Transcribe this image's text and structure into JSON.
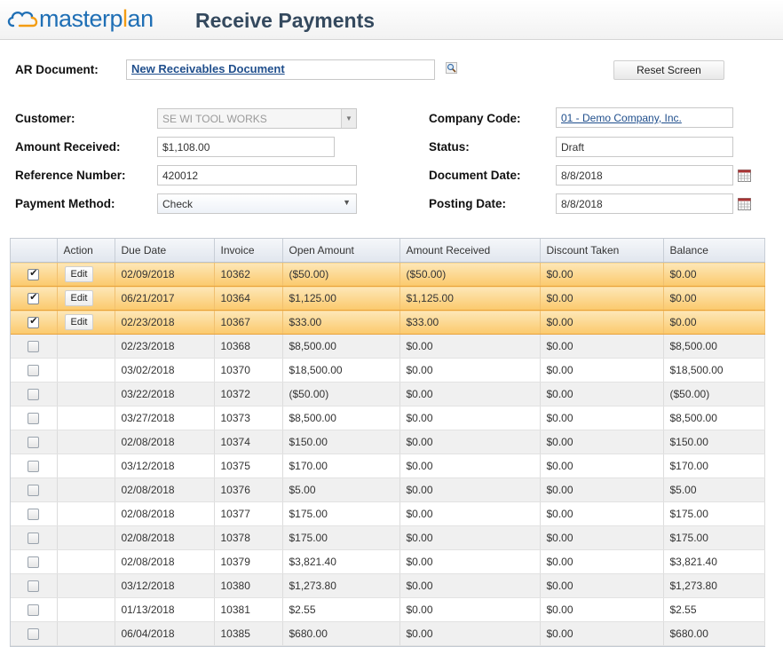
{
  "app": {
    "logo_text_a": "masterp",
    "logo_text_b": "l",
    "logo_text_c": "an",
    "page_title": "Receive Payments"
  },
  "header": {
    "ar_document_label": "AR Document:",
    "ar_document_value": "New Receivables Document",
    "reset_label": "Reset Screen"
  },
  "form": {
    "customer_label": "Customer:",
    "customer_value": "SE WI TOOL WORKS",
    "amount_label": "Amount Received:",
    "amount_value": "$1,108.00",
    "reference_label": "Reference Number:",
    "reference_value": "420012",
    "payment_method_label": "Payment Method:",
    "payment_method_value": "Check",
    "company_code_label": "Company Code:",
    "company_code_value": "01 - Demo Company, Inc.",
    "status_label": "Status:",
    "status_value": "Draft",
    "document_date_label": "Document Date:",
    "document_date_value": "8/8/2018",
    "posting_date_label": "Posting Date:",
    "posting_date_value": "8/8/2018"
  },
  "grid": {
    "columns": [
      "",
      "Action",
      "Due Date",
      "Invoice",
      "Open Amount",
      "Amount Received",
      "Discount Taken",
      "Balance"
    ],
    "edit_label": "Edit",
    "rows": [
      {
        "checked": true,
        "due": "02/09/2018",
        "invoice": "10362",
        "open": "($50.00)",
        "received": "($50.00)",
        "discount": "$0.00",
        "balance": "$0.00"
      },
      {
        "checked": true,
        "due": "06/21/2017",
        "invoice": "10364",
        "open": "$1,125.00",
        "received": "$1,125.00",
        "discount": "$0.00",
        "balance": "$0.00"
      },
      {
        "checked": true,
        "due": "02/23/2018",
        "invoice": "10367",
        "open": "$33.00",
        "received": "$33.00",
        "discount": "$0.00",
        "balance": "$0.00"
      },
      {
        "checked": false,
        "due": "02/23/2018",
        "invoice": "10368",
        "open": "$8,500.00",
        "received": "$0.00",
        "discount": "$0.00",
        "balance": "$8,500.00"
      },
      {
        "checked": false,
        "due": "03/02/2018",
        "invoice": "10370",
        "open": "$18,500.00",
        "received": "$0.00",
        "discount": "$0.00",
        "balance": "$18,500.00"
      },
      {
        "checked": false,
        "due": "03/22/2018",
        "invoice": "10372",
        "open": "($50.00)",
        "received": "$0.00",
        "discount": "$0.00",
        "balance": "($50.00)"
      },
      {
        "checked": false,
        "due": "03/27/2018",
        "invoice": "10373",
        "open": "$8,500.00",
        "received": "$0.00",
        "discount": "$0.00",
        "balance": "$8,500.00"
      },
      {
        "checked": false,
        "due": "02/08/2018",
        "invoice": "10374",
        "open": "$150.00",
        "received": "$0.00",
        "discount": "$0.00",
        "balance": "$150.00"
      },
      {
        "checked": false,
        "due": "03/12/2018",
        "invoice": "10375",
        "open": "$170.00",
        "received": "$0.00",
        "discount": "$0.00",
        "balance": "$170.00"
      },
      {
        "checked": false,
        "due": "02/08/2018",
        "invoice": "10376",
        "open": "$5.00",
        "received": "$0.00",
        "discount": "$0.00",
        "balance": "$5.00"
      },
      {
        "checked": false,
        "due": "02/08/2018",
        "invoice": "10377",
        "open": "$175.00",
        "received": "$0.00",
        "discount": "$0.00",
        "balance": "$175.00"
      },
      {
        "checked": false,
        "due": "02/08/2018",
        "invoice": "10378",
        "open": "$175.00",
        "received": "$0.00",
        "discount": "$0.00",
        "balance": "$175.00"
      },
      {
        "checked": false,
        "due": "02/08/2018",
        "invoice": "10379",
        "open": "$3,821.40",
        "received": "$0.00",
        "discount": "$0.00",
        "balance": "$3,821.40"
      },
      {
        "checked": false,
        "due": "03/12/2018",
        "invoice": "10380",
        "open": "$1,273.80",
        "received": "$0.00",
        "discount": "$0.00",
        "balance": "$1,273.80"
      },
      {
        "checked": false,
        "due": "01/13/2018",
        "invoice": "10381",
        "open": "$2.55",
        "received": "$0.00",
        "discount": "$0.00",
        "balance": "$2.55"
      },
      {
        "checked": false,
        "due": "06/04/2018",
        "invoice": "10385",
        "open": "$680.00",
        "received": "$0.00",
        "discount": "$0.00",
        "balance": "$680.00"
      }
    ]
  },
  "icons": {
    "logo": "cloud-logo-icon",
    "lookup": "magnifier-icon",
    "calendar": "calendar-icon",
    "dropdown": "chevron-down-icon",
    "checkbox_checked": "checkmark-icon"
  },
  "colors": {
    "brand_blue": "#1f6fb5",
    "brand_orange": "#f39c12",
    "title": "#34495e",
    "selected_row": "#fbc96c",
    "link": "#1f4e8c"
  }
}
